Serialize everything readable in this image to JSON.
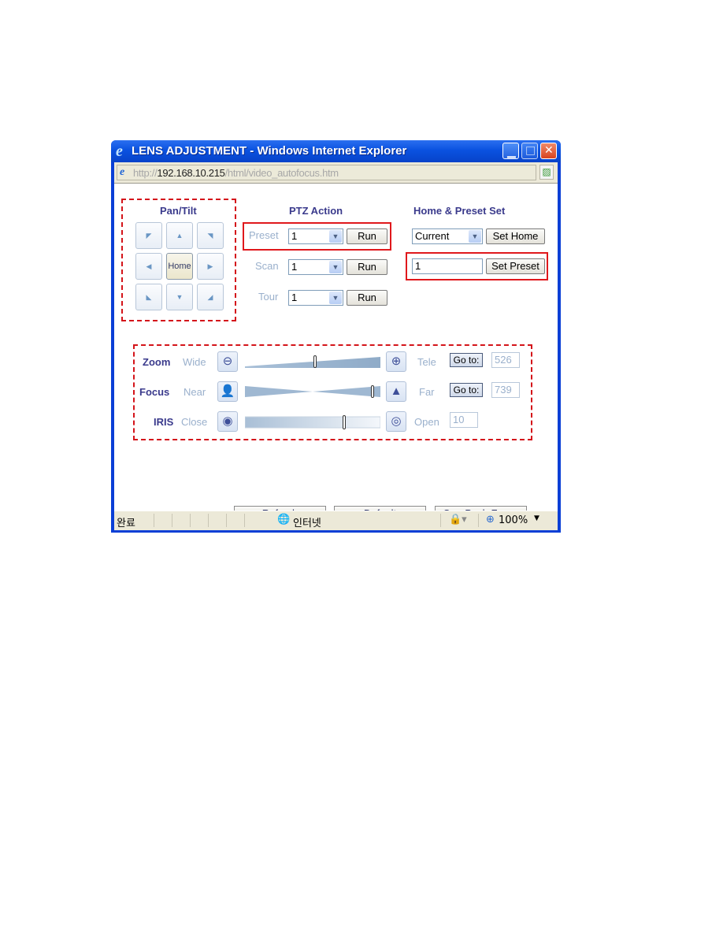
{
  "window": {
    "title": "LENS ADJUSTMENT - Windows Internet Explorer",
    "controls": {
      "minimize": "_",
      "maximize": "□",
      "close": "✕"
    }
  },
  "address_bar": {
    "scheme": "http://",
    "host": "192.168.10.215",
    "path": "/html/video_autofocus.htm"
  },
  "pan_tilt": {
    "title": "Pan/Tilt",
    "buttons": [
      {
        "name": "up-left",
        "glyph": "◤"
      },
      {
        "name": "up",
        "glyph": "▲"
      },
      {
        "name": "up-right",
        "glyph": "◥"
      },
      {
        "name": "left",
        "glyph": "◀"
      },
      {
        "name": "home",
        "glyph": "Home"
      },
      {
        "name": "right",
        "glyph": "▶"
      },
      {
        "name": "down-left",
        "glyph": "◣"
      },
      {
        "name": "down",
        "glyph": "▼"
      },
      {
        "name": "down-right",
        "glyph": "◢"
      }
    ]
  },
  "ptz_action": {
    "title": "PTZ Action",
    "rows": [
      {
        "label": "Preset",
        "value": "1",
        "button": "Run"
      },
      {
        "label": "Scan",
        "value": "1",
        "button": "Run"
      },
      {
        "label": "Tour",
        "value": "1",
        "button": "Run"
      }
    ]
  },
  "home_preset": {
    "title": "Home & Preset Set",
    "home_select": "Current",
    "set_home_label": "Set Home",
    "preset_value": "1",
    "set_preset_label": "Set Preset"
  },
  "lens": {
    "zoom": {
      "label": "Zoom",
      "min_label": "Wide",
      "max_label": "Tele",
      "goto_label": "Go to:",
      "value": "526",
      "slider_fraction": 0.52
    },
    "focus": {
      "label": "Focus",
      "min_label": "Near",
      "max_label": "Far",
      "goto_label": "Go to:",
      "value": "739",
      "slider_fraction": 0.94
    },
    "iris": {
      "label": "IRIS",
      "min_label": "Close",
      "max_label": "Open",
      "value": "10",
      "slider_fraction": 0.73
    }
  },
  "actions": {
    "refresh": "Refresh",
    "default": "Default",
    "one_push_focus": "One Push Focus"
  },
  "statusbar": {
    "status": "완료",
    "zone": "인터넷",
    "zoom": "100%"
  }
}
